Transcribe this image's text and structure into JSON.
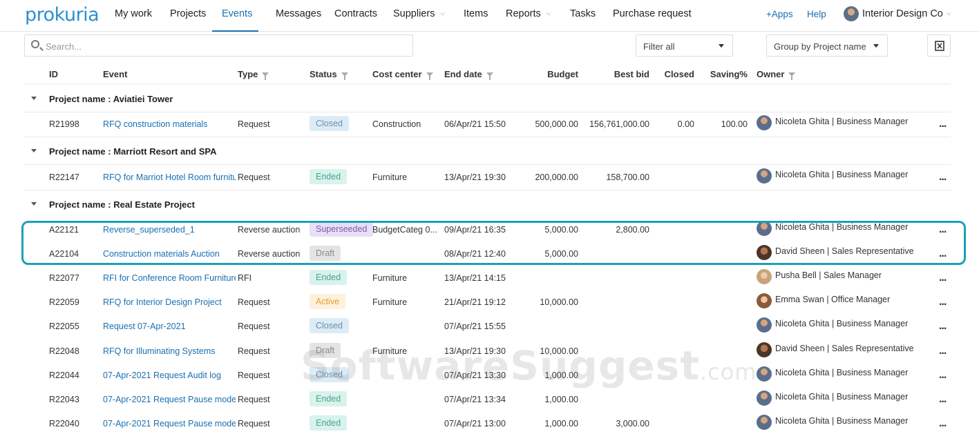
{
  "nav": {
    "logo": "prokuria",
    "items": [
      "My work",
      "Projects",
      "Events",
      "Messages",
      "Contracts",
      "Suppliers",
      "Items",
      "Reports",
      "Tasks",
      "Purchase request"
    ],
    "active": "Events",
    "apps": "+Apps",
    "help": "Help",
    "company": "Interior Design Co"
  },
  "toolbar": {
    "search_placeholder": "Search...",
    "filter": "Filter all",
    "group_by": "Group by Project name"
  },
  "columns": {
    "id": "ID",
    "event": "Event",
    "type": "Type",
    "status": "Status",
    "cost_center": "Cost center",
    "end_date": "End date",
    "budget": "Budget",
    "best_bid": "Best bid",
    "closed": "Closed",
    "saving": "Saving%",
    "owner": "Owner"
  },
  "colors": {
    "accent": "#1a6fb0",
    "highlight": "#1ba0b8",
    "status_closed_bg": "#dcecf7",
    "status_closed_fg": "#6a8eaa",
    "status_ended_bg": "#d8f2ec",
    "status_ended_fg": "#4aa290",
    "status_superseeded_bg": "#e8def6",
    "status_superseeded_fg": "#7e5aa8",
    "status_draft_bg": "#e4e4e4",
    "status_draft_fg": "#8a8a8a",
    "status_active_bg": "#fdf1dc",
    "status_active_fg": "#e0a030"
  },
  "groups": [
    {
      "title": "Project name : Aviatiei Tower"
    },
    {
      "title": "Project name : Marriott Resort and SPA"
    },
    {
      "title": "Project name : Real Estate Project"
    }
  ],
  "rows": [
    {
      "id": "R21998",
      "event": "RFQ construction materials",
      "type": "Request",
      "status": "Closed",
      "cost_center": "Construction",
      "end_date": "06/Apr/21 15:50",
      "budget": "500,000.00",
      "best_bid": "156,761,000.00",
      "closed": "0.00",
      "saving": "100.00",
      "owner": "Nicoleta Ghita | Business Manager",
      "avatar": "man-blue"
    },
    {
      "id": "R22147",
      "event": "RFQ for Marriot Hotel Room furniture",
      "type": "Request",
      "status": "Ended",
      "cost_center": "Furniture",
      "end_date": "13/Apr/21 19:30",
      "budget": "200,000.00",
      "best_bid": "158,700.00",
      "closed": "",
      "saving": "",
      "owner": "Nicoleta Ghita | Business Manager",
      "avatar": "man-blue"
    },
    {
      "id": "A22121",
      "event": "Reverse_superseded_1",
      "type": "Reverse auction",
      "status": "Superseeded",
      "cost_center": "BudgetCateg 0...",
      "end_date": "09/Apr/21 16:35",
      "budget": "5,000.00",
      "best_bid": "2,800.00",
      "closed": "",
      "saving": "",
      "owner": "Nicoleta Ghita | Business Manager",
      "avatar": "man-blue"
    },
    {
      "id": "A22104",
      "event": "Construction materials Auction",
      "type": "Reverse auction",
      "status": "Draft",
      "cost_center": "",
      "end_date": "08/Apr/21 12:40",
      "budget": "5,000.00",
      "best_bid": "",
      "closed": "",
      "saving": "",
      "owner": "David Sheen | Sales Representative",
      "avatar": "man-dark"
    },
    {
      "id": "R22077",
      "event": "RFI for Conference Room Furniture",
      "type": "RFI",
      "status": "Ended",
      "cost_center": "Furniture",
      "end_date": "13/Apr/21 14:15",
      "budget": "",
      "best_bid": "",
      "closed": "",
      "saving": "",
      "owner": "Pusha Bell | Sales Manager",
      "avatar": "woman-light"
    },
    {
      "id": "R22059",
      "event": "RFQ for Interior Design Project",
      "type": "Request",
      "status": "Active",
      "cost_center": "Furniture",
      "end_date": "21/Apr/21 19:12",
      "budget": "10,000.00",
      "best_bid": "",
      "closed": "",
      "saving": "",
      "owner": "Emma Swan | Office Manager",
      "avatar": "woman-brown"
    },
    {
      "id": "R22055",
      "event": "Request 07-Apr-2021",
      "type": "Request",
      "status": "Closed",
      "cost_center": "",
      "end_date": "07/Apr/21 15:55",
      "budget": "",
      "best_bid": "",
      "closed": "",
      "saving": "",
      "owner": "Nicoleta Ghita | Business Manager",
      "avatar": "man-blue"
    },
    {
      "id": "R22048",
      "event": "RFQ for Illuminating Systems",
      "type": "Request",
      "status": "Draft",
      "cost_center": "Furniture",
      "end_date": "13/Apr/21 19:30",
      "budget": "10,000.00",
      "best_bid": "",
      "closed": "",
      "saving": "",
      "owner": "David Sheen | Sales Representative",
      "avatar": "man-dark"
    },
    {
      "id": "R22044",
      "event": "07-Apr-2021 Request Audit log",
      "type": "Request",
      "status": "Closed",
      "cost_center": "",
      "end_date": "07/Apr/21 13:30",
      "budget": "1,000.00",
      "best_bid": "",
      "closed": "",
      "saving": "",
      "owner": "Nicoleta Ghita | Business Manager",
      "avatar": "man-blue"
    },
    {
      "id": "R22043",
      "event": "07-Apr-2021 Request Pause mode",
      "type": "Request",
      "status": "Ended",
      "cost_center": "",
      "end_date": "07/Apr/21 13:34",
      "budget": "1,000.00",
      "best_bid": "",
      "closed": "",
      "saving": "",
      "owner": "Nicoleta Ghita | Business Manager",
      "avatar": "man-blue"
    },
    {
      "id": "R22040",
      "event": "07-Apr-2021 Request Pause mode",
      "type": "Request",
      "status": "Ended",
      "cost_center": "",
      "end_date": "07/Apr/21 13:00",
      "budget": "1,000.00",
      "best_bid": "3,000.00",
      "closed": "",
      "saving": "",
      "owner": "Nicoleta Ghita | Business Manager",
      "avatar": "man-blue"
    }
  ],
  "more_label": "...",
  "watermark": {
    "main": "SoftwareSuggest",
    "suffix": ".com"
  }
}
